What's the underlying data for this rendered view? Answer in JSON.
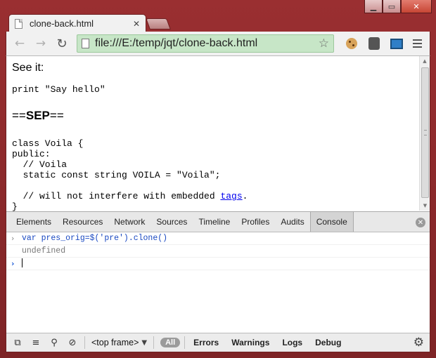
{
  "window": {
    "controls": {
      "minimize": "▁",
      "maximize": "▭",
      "close": "✕"
    }
  },
  "tab": {
    "title": "clone-back.html",
    "close": "✕"
  },
  "toolbar": {
    "back": "←",
    "forward": "→",
    "reload": "↻",
    "url": "file:///E:/temp/jqt/clone-back.html",
    "star": "☆"
  },
  "page": {
    "see_it": "See it:",
    "code1": "print \"Say hello\"",
    "sep_prefix": "==",
    "sep_bold": "SEP",
    "sep_suffix": "==",
    "code2_before": "class Voila {\npublic:\n  // Voila\n  static const string VOILA = \"Voila\";\n\n  // will not interfere with embedded ",
    "code2_link": "tags",
    "code2_after": ".\n}"
  },
  "devtools": {
    "tabs": [
      "Elements",
      "Resources",
      "Network",
      "Sources",
      "Timeline",
      "Profiles",
      "Audits",
      "Console"
    ],
    "active_tab": "Console",
    "console": {
      "input_chevron": "›",
      "input": "var pres_orig=$('pre').clone()",
      "result": "undefined",
      "prompt_chevron": "›"
    },
    "status_bar": {
      "frame": "<top frame>",
      "dropdown": "▼",
      "all_pill": "All",
      "filters": [
        "Errors",
        "Warnings",
        "Logs",
        "Debug"
      ],
      "gear": "⚙"
    }
  },
  "colors": {
    "frame": "#8b2a2c",
    "omnibox": "#c7e6c7",
    "link": "#0000ee",
    "console_input": "#1a49c2"
  }
}
